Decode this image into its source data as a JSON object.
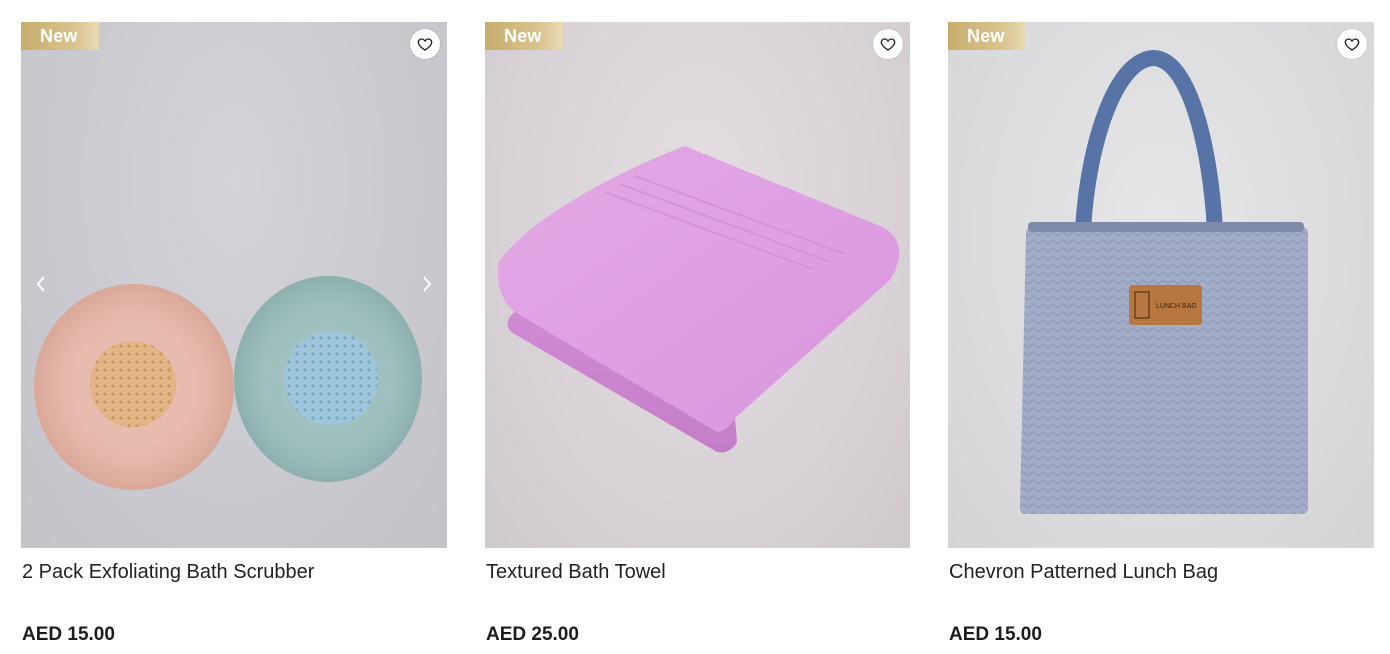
{
  "products": [
    {
      "badge": "New",
      "name": "2 Pack Exfoliating Bath Scrubber",
      "price": "AED 15.00",
      "wishlist_icon": "heart-outline-icon",
      "carousel": {
        "prev_icon": "chevron-left-icon",
        "next_icon": "chevron-right-icon"
      }
    },
    {
      "badge": "New",
      "name": "Textured Bath Towel",
      "price": "AED 25.00",
      "wishlist_icon": "heart-outline-icon"
    },
    {
      "badge": "New",
      "name": "Chevron Patterned Lunch Bag",
      "price": "AED 15.00",
      "wishlist_icon": "heart-outline-icon",
      "label_text": "LUNCH BAG"
    }
  ],
  "colors": {
    "badge_gold": "#c8ad6d",
    "text": "#222222",
    "background": "#ffffff"
  }
}
